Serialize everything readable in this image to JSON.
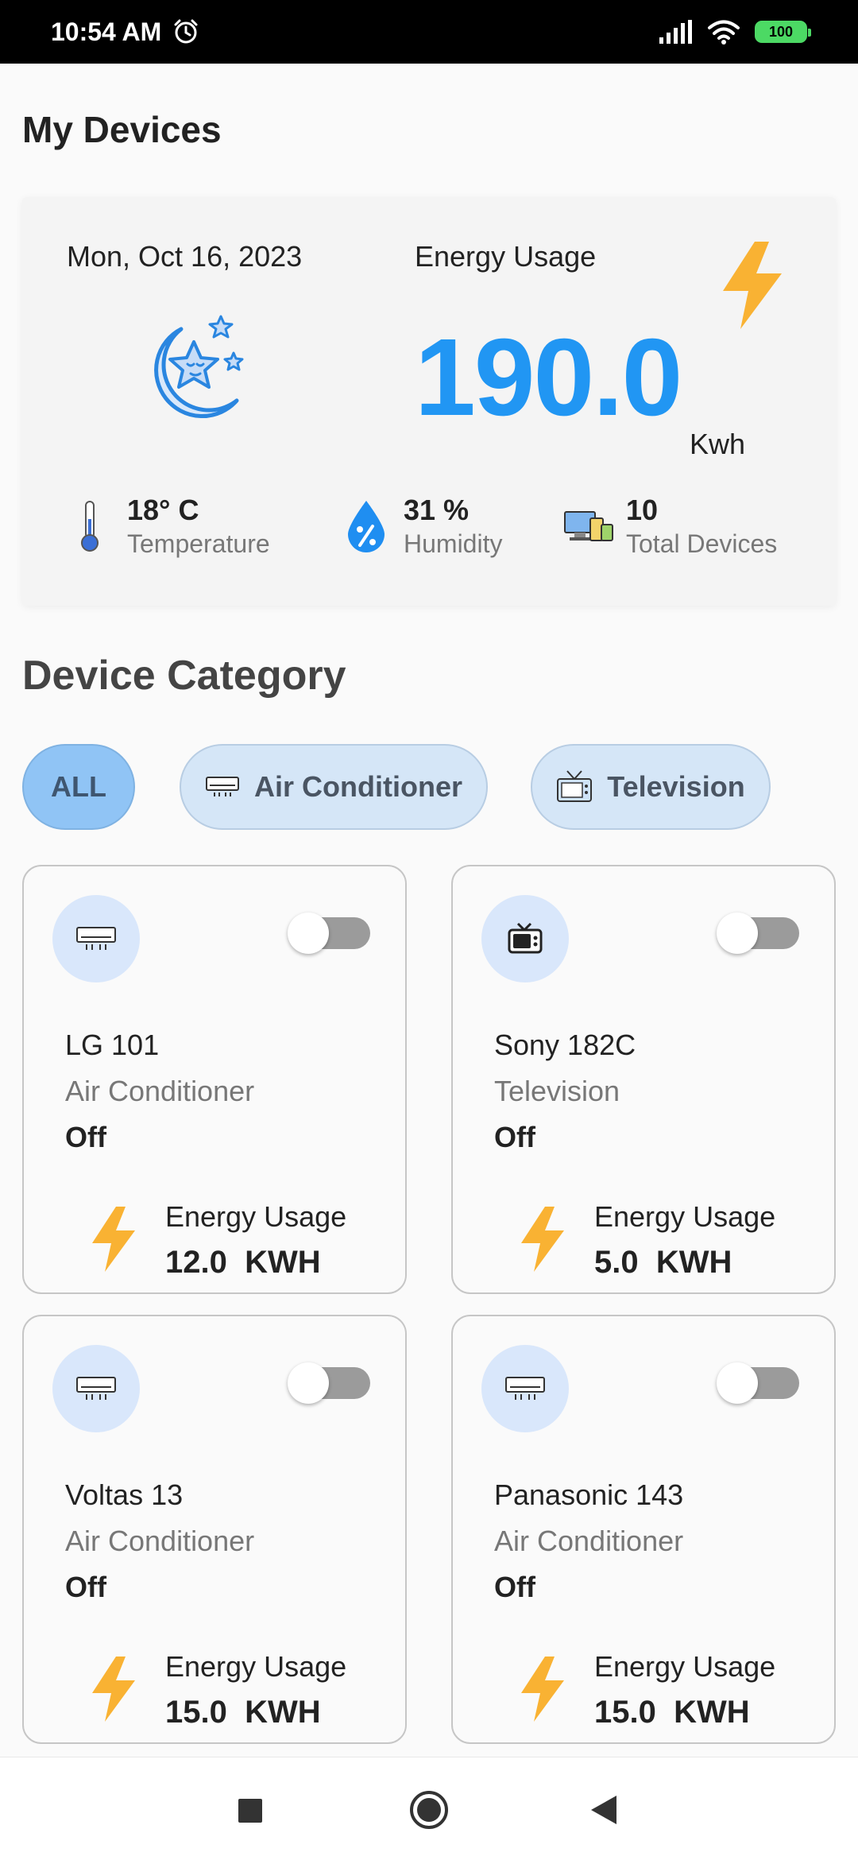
{
  "status_bar": {
    "time": "10:54 AM",
    "battery": "100"
  },
  "page_title": "My Devices",
  "summary": {
    "date": "Mon, Oct 16, 2023",
    "energy_title": "Energy Usage",
    "energy_value": "190.0",
    "energy_unit": "Kwh",
    "temperature_value": "18° C",
    "temperature_label": "Temperature",
    "humidity_value": "31 %",
    "humidity_label": "Humidity",
    "devices_value": "10",
    "devices_label": "Total Devices"
  },
  "category": {
    "title": "Device Category",
    "chips": [
      {
        "label": "ALL",
        "selected": true
      },
      {
        "label": "Air Conditioner",
        "icon": "air-conditioner-icon"
      },
      {
        "label": "Television",
        "icon": "television-icon"
      }
    ]
  },
  "devices": [
    {
      "name": "LG 101",
      "type": "Air Conditioner",
      "state": "Off",
      "usage_label": "Energy Usage",
      "usage": "12.0  KWH",
      "icon": "air-conditioner-icon",
      "on": false
    },
    {
      "name": "Sony 182C",
      "type": "Television",
      "state": "Off",
      "usage_label": "Energy Usage",
      "usage": "5.0  KWH",
      "icon": "television-icon",
      "on": false
    },
    {
      "name": "Voltas 13",
      "type": "Air Conditioner",
      "state": "Off",
      "usage_label": "Energy Usage",
      "usage": "15.0  KWH",
      "icon": "air-conditioner-icon",
      "on": false
    },
    {
      "name": "Panasonic 143",
      "type": "Air Conditioner",
      "state": "Off",
      "usage_label": "Energy Usage",
      "usage": "15.0  KWH",
      "icon": "air-conditioner-icon",
      "on": false
    }
  ],
  "colors": {
    "accent": "#2196f3",
    "bolt": "#f9b233",
    "chip_selected": "#90c4f5",
    "chip": "#d5e6f7"
  }
}
